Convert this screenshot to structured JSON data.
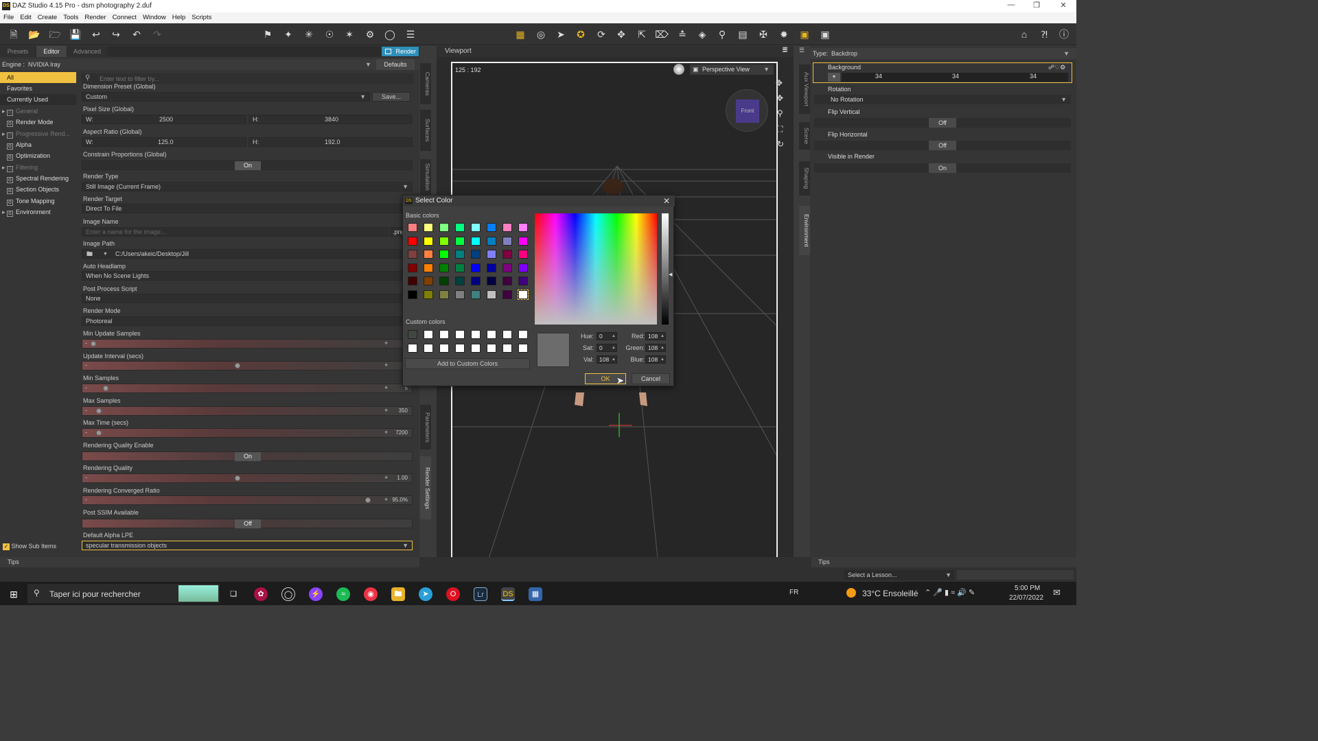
{
  "window": {
    "title": "DAZ Studio 4.15 Pro - dsm photography 2.duf",
    "logo": "DS"
  },
  "menu": [
    "File",
    "Edit",
    "Create",
    "Tools",
    "Render",
    "Connect",
    "Window",
    "Help",
    "Scripts"
  ],
  "left_panel": {
    "tabs": [
      "Presets",
      "Editor",
      "Advanced"
    ],
    "render_button": "Render",
    "engine_label": "Engine :",
    "engine_value": "NVIDIA Iray",
    "defaults_button": "Defaults",
    "filter_placeholder": "Enter text to filter by...",
    "categories": [
      {
        "label": "All",
        "selected": true
      },
      {
        "label": "Favorites"
      },
      {
        "label": "Currently Used"
      },
      {
        "label": "General",
        "group": true,
        "dim": true,
        "expand": true
      },
      {
        "label": "Render Mode",
        "group": true
      },
      {
        "label": "Progressive Rend...",
        "group": true,
        "dim": true,
        "expand": true
      },
      {
        "label": "Alpha",
        "group": true
      },
      {
        "label": "Optimization",
        "group": true
      },
      {
        "label": "Filtering",
        "group": true,
        "dim": true,
        "expand": true
      },
      {
        "label": "Spectral Rendering",
        "group": true
      },
      {
        "label": "Section Objects",
        "group": true
      },
      {
        "label": "Tone Mapping",
        "group": true
      },
      {
        "label": "Environment",
        "group": true,
        "expand": true
      }
    ],
    "show_sub_items": "Show Sub Items",
    "settings": {
      "dimension_preset_label": "Dimension Preset (Global)",
      "dimension_preset_value": "Custom",
      "save_button": "Save...",
      "pixel_size_label": "Pixel Size (Global)",
      "pixel_w": "2500",
      "pixel_h": "3840",
      "aspect_label": "Aspect Ratio (Global)",
      "aspect_w": "125.0",
      "aspect_h": "192.0",
      "w_label": "W:",
      "h_label": "H:",
      "constrain_label": "Constrain Proportions (Global)",
      "constrain_value": "On",
      "render_type_label": "Render Type",
      "render_type_value": "Still Image (Current Frame)",
      "render_target_label": "Render Target",
      "render_target_value": "Direct To File",
      "image_name_label": "Image Name",
      "image_name_placeholder": "Enter a name for the image...",
      "image_ext": ".png",
      "image_path_label": "Image Path",
      "image_path_value": "C:/Users/akeic/Desktop/Jill",
      "auto_headlamp_label": "Auto Headlamp",
      "auto_headlamp_value": "When No Scene Lights",
      "post_script_label": "Post Process Script",
      "post_script_value": "None",
      "render_mode_label": "Render Mode",
      "render_mode_value": "Photoreal",
      "min_update_label": "Min Update Samples",
      "update_interval_label": "Update Interval (secs)",
      "update_interval_value": "5",
      "min_samples_label": "Min Samples",
      "min_samples_value": "5",
      "max_samples_label": "Max Samples",
      "max_samples_value": "350",
      "max_time_label": "Max Time (secs)",
      "max_time_value": "7200",
      "rq_enable_label": "Rendering Quality Enable",
      "rq_enable_value": "On",
      "rq_label": "Rendering Quality",
      "rq_value": "1.00",
      "rcr_label": "Rendering Converged Ratio",
      "rcr_value": "95.0%",
      "ssim_label": "Post SSIM Available",
      "ssim_value": "Off",
      "alpha_lpe_label": "Default Alpha LPE",
      "alpha_lpe_value": "specular transmission objects"
    },
    "side_tabs": [
      "Cameras",
      "Surfaces",
      "Simulation",
      "Parameters",
      "Render Settings"
    ],
    "tips": "Tips"
  },
  "viewport": {
    "title": "Viewport",
    "ratio": "125 : 192",
    "view_mode": "Perspective View",
    "cube_face": "Front"
  },
  "right_panel": {
    "type_label": "Type:",
    "type_value": "Backdrop",
    "background_label": "Background",
    "bg_values": [
      "34",
      "34",
      "34"
    ],
    "rotation_label": "Rotation",
    "rotation_value": "No Rotation",
    "flip_v_label": "Flip Vertical",
    "flip_v_value": "Off",
    "flip_h_label": "Flip Horizontal",
    "flip_h_value": "Off",
    "visible_label": "Visible in Render",
    "visible_value": "On",
    "side_tabs": [
      "Aux Viewport",
      "Scene",
      "Shaping",
      "Environment"
    ],
    "tips": "Tips",
    "lesson_placeholder": "Select a Lesson..."
  },
  "dialog": {
    "title": "Select Color",
    "basic_colors_label": "Basic colors",
    "custom_colors_label": "Custom colors",
    "add_custom_button": "Add to Custom Colors",
    "hue_label": "Hue:",
    "hue": "0",
    "sat_label": "Sat:",
    "sat": "0",
    "val_label": "Val:",
    "val": "108",
    "red_label": "Red:",
    "red": "108",
    "green_label": "Green:",
    "green": "108",
    "blue_label": "Blue:",
    "blue": "108",
    "ok": "OK",
    "cancel": "Cancel",
    "basic_colors": [
      "#ff8080",
      "#ffff80",
      "#80ff80",
      "#00ff80",
      "#80ffff",
      "#0080ff",
      "#ff80c0",
      "#ff80ff",
      "#ff0000",
      "#ffff00",
      "#80ff00",
      "#00ff40",
      "#00ffff",
      "#0080c0",
      "#8080c0",
      "#ff00ff",
      "#804040",
      "#ff8040",
      "#00ff00",
      "#008080",
      "#004080",
      "#8080ff",
      "#800040",
      "#ff0080",
      "#800000",
      "#ff8000",
      "#008000",
      "#008040",
      "#0000ff",
      "#0000a0",
      "#800080",
      "#8000ff",
      "#400000",
      "#804000",
      "#004000",
      "#004040",
      "#000080",
      "#000040",
      "#400040",
      "#400080",
      "#000000",
      "#808000",
      "#808040",
      "#808080",
      "#408080",
      "#c0c0c0",
      "#400040",
      "#ffffff"
    ],
    "custom_colors": [
      "#404840",
      "#ffffff",
      "#ffffff",
      "#ffffff",
      "#ffffff",
      "#ffffff",
      "#ffffff",
      "#ffffff",
      "#ffffff",
      "#ffffff",
      "#ffffff",
      "#ffffff",
      "#ffffff",
      "#ffffff",
      "#ffffff",
      "#ffffff"
    ],
    "current_color": "#6c6c6c"
  },
  "taskbar": {
    "search_placeholder": "Taper ici pour rechercher",
    "lang": "FR",
    "weather": "33°C Ensoleillé",
    "time": "5:00 PM",
    "date": "22/07/2022"
  },
  "colors": {
    "accent": "#f0c040",
    "render_blue": "#2e8fb8"
  }
}
